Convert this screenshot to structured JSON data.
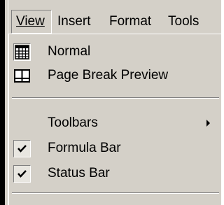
{
  "menubar": {
    "items": [
      {
        "label": "View",
        "active": true
      },
      {
        "label": "Insert",
        "active": false
      },
      {
        "label": "Format",
        "active": false
      },
      {
        "label": "Tools",
        "active": false
      }
    ]
  },
  "view_menu": {
    "items": [
      {
        "label": "Normal",
        "icon": "normal-view-grid-icon",
        "pressed": true
      },
      {
        "label": "Page Break Preview",
        "icon": "page-break-preview-icon",
        "pressed": false
      },
      {
        "label": "Toolbars",
        "has_submenu": true
      },
      {
        "label": "Formula Bar",
        "checked": true
      },
      {
        "label": "Status Bar",
        "checked": true
      }
    ]
  },
  "colors": {
    "face": "#d4d0c8",
    "shadow": "#808080",
    "highlight": "#ffffff",
    "text": "#000000"
  }
}
